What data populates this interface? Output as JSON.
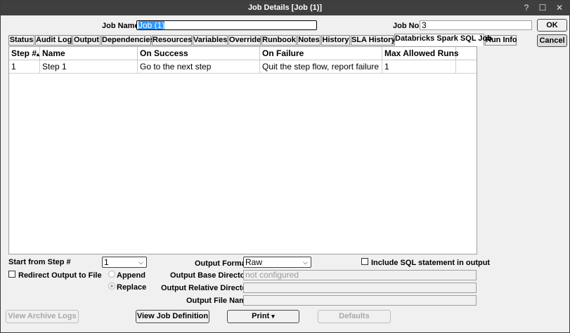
{
  "window": {
    "title": "Job Details [Job (1)]",
    "help_glyph": "?",
    "maximize_glyph": "☐",
    "close_glyph": "✕"
  },
  "job": {
    "name_label": "Job Name",
    "name_value": "Job (1)",
    "no_label": "Job No.",
    "no_value": "3"
  },
  "buttons": {
    "ok": "OK",
    "cancel": "Cancel",
    "view_archive_logs": "View Archive Logs",
    "view_job_definition": "View Job Definition",
    "print": "Print",
    "print_arrow": "▾",
    "defaults": "Defaults"
  },
  "tabs": [
    {
      "label": "Status"
    },
    {
      "label": "Audit Log"
    },
    {
      "label": "Output"
    },
    {
      "label": "Dependencies"
    },
    {
      "label": "Resources"
    },
    {
      "label": "Variables"
    },
    {
      "label": "Override"
    },
    {
      "label": "Runbook"
    },
    {
      "label": "Notes"
    },
    {
      "label": "History"
    },
    {
      "label": "SLA History"
    },
    {
      "label": "Databricks Spark SQL Job"
    },
    {
      "label": "Run Info"
    }
  ],
  "active_tab": "Databricks Spark SQL Job",
  "grid": {
    "columns": [
      "Step #",
      "Name",
      "On Success",
      "On Failure",
      "Max Allowed Runs"
    ],
    "sort_glyph": "▴",
    "rows": [
      [
        "1",
        "Step 1",
        "Go to the next step",
        "Quit the step flow, report failure",
        "1"
      ]
    ]
  },
  "form": {
    "start_from_label": "Start from Step #",
    "start_from_value": "1",
    "output_format_label": "Output Format",
    "output_format_value": "Raw",
    "include_sql_label": "Include SQL statement in output",
    "include_sql_checked": false,
    "redirect_label": "Redirect Output to File",
    "redirect_checked": false,
    "append_label": "Append",
    "replace_label": "Replace",
    "output_mode_selected": "Replace",
    "base_dir_label": "Output Base Directory",
    "base_dir_value": "not configured",
    "relative_dir_label": "Output Relative Directory",
    "relative_dir_value": "",
    "file_name_label": "Output File Name",
    "file_name_value": ""
  },
  "dropdown_glyph": "⌄"
}
